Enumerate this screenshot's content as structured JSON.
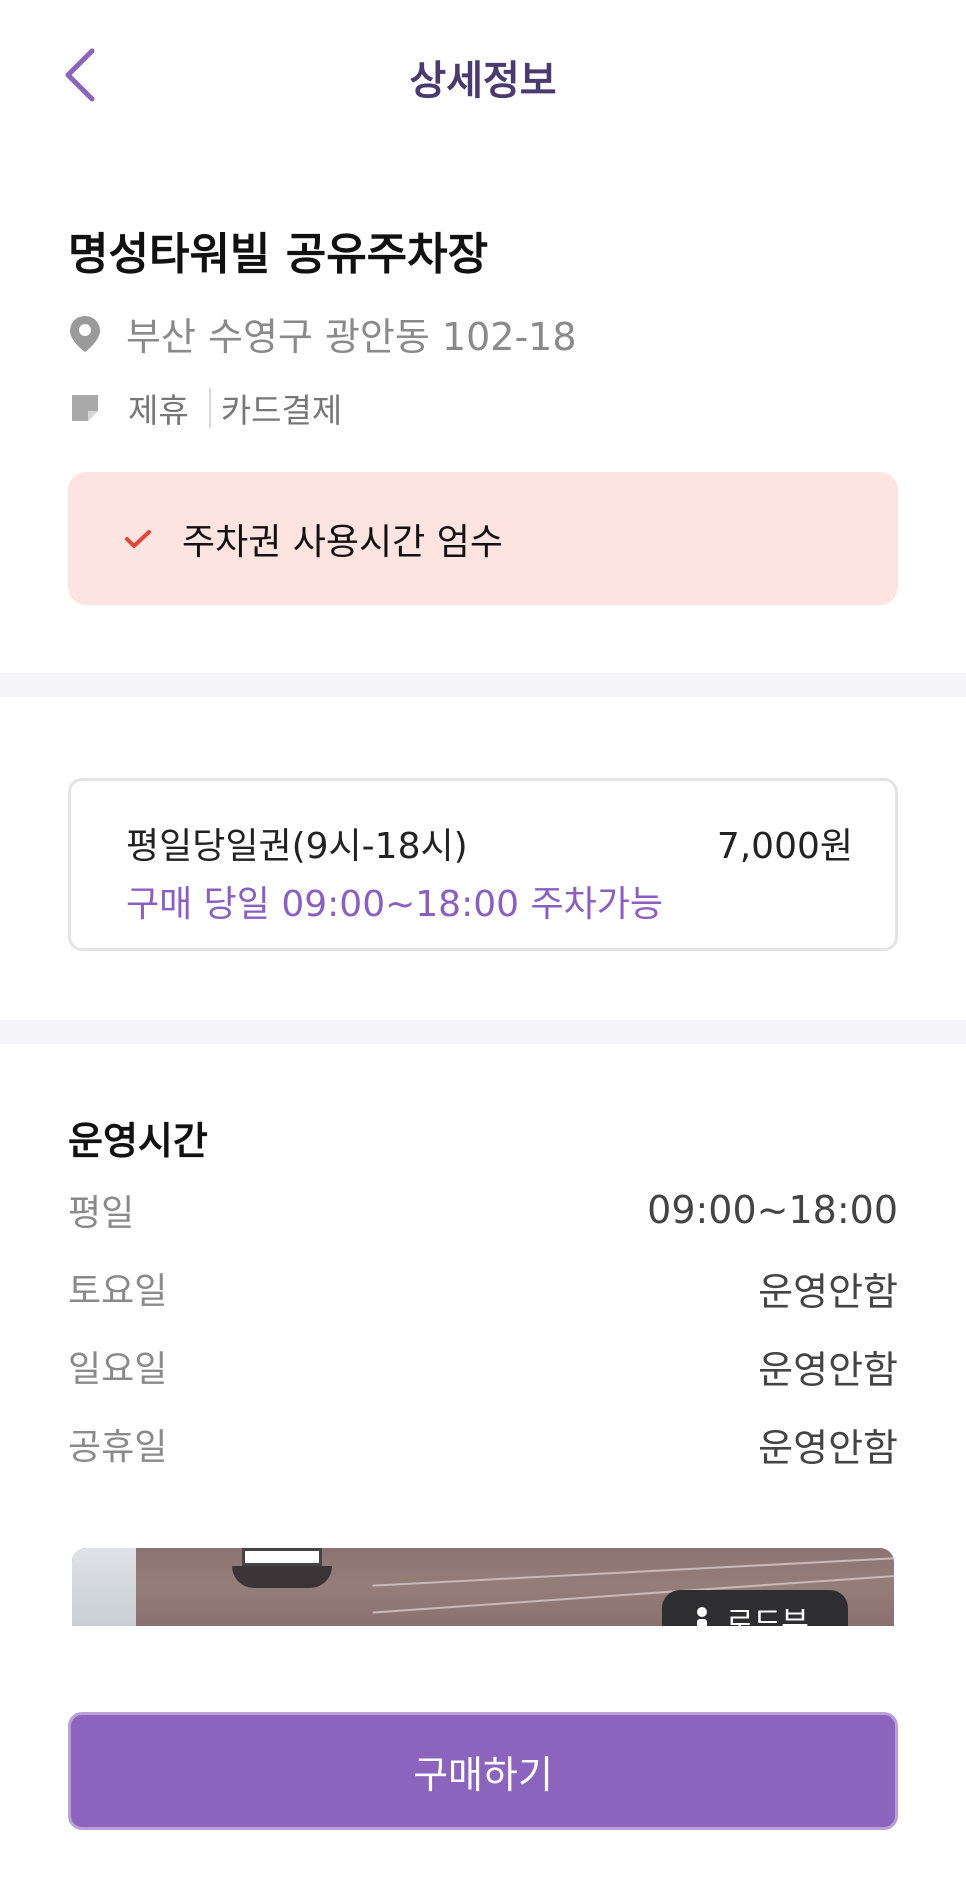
{
  "header": {
    "title": "상세정보",
    "back_icon": "chevron-left-icon"
  },
  "lot": {
    "name": "명성타워빌 공유주차장",
    "address": "부산 수영구 광안동 102-18",
    "tags": [
      "제휴",
      "카드결제"
    ]
  },
  "notice": {
    "text": "주차권 사용시간 엄수"
  },
  "ticket": {
    "name": "평일당일권(9시-18시)",
    "price": "7,000원",
    "desc": "구매 당일 09:00~18:00 주차가능"
  },
  "hours": {
    "title": "운영시간",
    "rows": [
      {
        "day": "평일",
        "time": "09:00~18:00"
      },
      {
        "day": "토요일",
        "time": "운영안함"
      },
      {
        "day": "일요일",
        "time": "운영안함"
      },
      {
        "day": "공휴일",
        "time": "운영안함"
      }
    ]
  },
  "photo": {
    "roadview_label": "로드뷰"
  },
  "buy_button": {
    "label": "구매하기"
  },
  "colors": {
    "accent": "#8c63bd",
    "title": "#4a3a6e",
    "notice_bg": "#fde4e0",
    "check": "#e0463c"
  }
}
